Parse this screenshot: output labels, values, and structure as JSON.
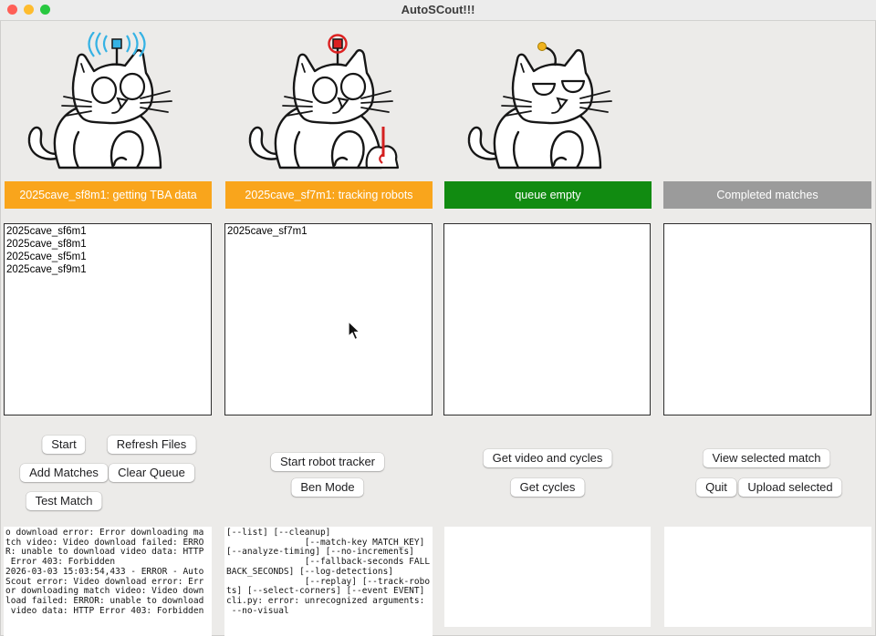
{
  "titlebar": {
    "title": "AutoSCout!!!",
    "traffic_lights": {
      "close": "#ff5f57",
      "minimize": "#febc2e",
      "zoom": "#28c840"
    }
  },
  "cats": {
    "tba": {
      "description": "pixel cat with broadcasting antenna",
      "antenna_color": "#35b2e4",
      "eyes": "open"
    },
    "tracker": {
      "description": "pixel cat with recording antenna and pencil",
      "antenna_color": "#dc2020",
      "eyes": "open"
    },
    "queue": {
      "description": "sleeping pixel cat with idle antenna",
      "antenna_color": "#f0b31e",
      "eyes": "closed"
    }
  },
  "status_bars": {
    "tba": {
      "label": "2025cave_sf8m1: getting TBA data",
      "color": "#f9a51c"
    },
    "tracker": {
      "label": "2025cave_sf7m1: tracking robots",
      "color": "#f9a51c"
    },
    "queue": {
      "label": "queue empty",
      "color": "#118b11"
    },
    "completed": {
      "label": "Completed matches",
      "color": "#9b9b9b"
    }
  },
  "lists": {
    "files": {
      "items": [
        "2025cave_sf6m1",
        "2025cave_sf8m1",
        "2025cave_sf5m1",
        "2025cave_sf9m1"
      ]
    },
    "tracking": {
      "items": [
        "2025cave_sf7m1"
      ]
    },
    "queue": {
      "items": []
    },
    "completed": {
      "items": []
    }
  },
  "buttons": {
    "start": "Start",
    "refresh_files": "Refresh Files",
    "add_matches": "Add Matches",
    "clear_queue": "Clear Queue",
    "test_match": "Test Match",
    "start_robot_tracker": "Start robot tracker",
    "ben_mode": "Ben Mode",
    "get_video_and_cycles": "Get video and cycles",
    "get_cycles": "Get cycles",
    "view_selected_match": "View selected match",
    "quit": "Quit",
    "upload_selected": "Upload selected"
  },
  "logs": {
    "downloader": "o download error: Error downloading ma\ntch video: Video download failed: ERRO\nR: unable to download video data: HTTP\n Error 403: Forbidden\n2026-03-03 15:03:54,433 - ERROR - Auto\nScout error: Video download error: Err\nor downloading match video: Video down\nload failed: ERROR: unable to download\n video data: HTTP Error 403: Forbidden",
    "tracker": "[--list] [--cleanup]\n               [--match-key MATCH_KEY]\n[--analyze-timing] [--no-increments]\n               [--fallback-seconds FALL\nBACK_SECONDS] [--log-detections]\n               [--replay] [--track-robo\nts] [--select-corners] [--event EVENT]\ncli.py: error: unrecognized arguments:\n --no-visual"
  }
}
